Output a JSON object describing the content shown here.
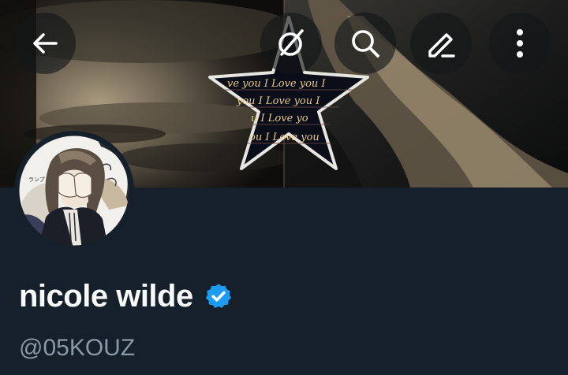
{
  "colors": {
    "background": "#15202b",
    "primary_text": "#f7f9f9",
    "secondary_text": "#8b98a5",
    "verified_badge": "#1d9bf0",
    "toolbar_button_bg": "rgba(20,22,24,0.62)"
  },
  "toolbar": {
    "back_icon": "arrow-left-icon",
    "grok_icon": "grok-icon",
    "search_icon": "search-icon",
    "edit_icon": "pencil-icon",
    "more_icon": "more-vertical-icon"
  },
  "banner": {
    "star_text": "you I Love you"
  },
  "profile": {
    "display_name": "nicole wilde",
    "verified": true,
    "verified_icon": "verified-badge-icon",
    "handle": "@05KOUZ"
  }
}
